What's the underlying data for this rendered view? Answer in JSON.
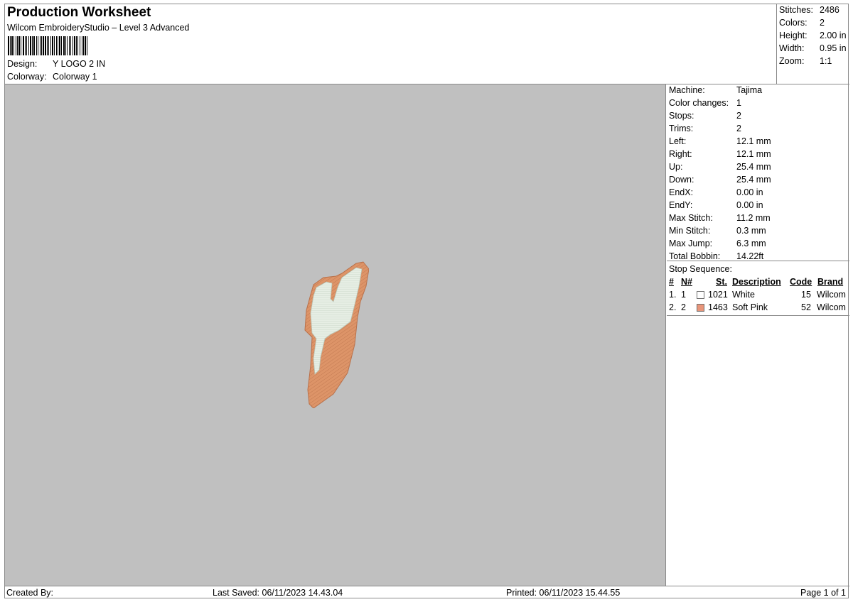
{
  "header": {
    "title": "Production Worksheet",
    "subtitle": "Wilcom EmbroideryStudio – Level 3 Advanced",
    "design_label": "Design:",
    "design_value": "Y LOGO 2 IN",
    "colorway_label": "Colorway:",
    "colorway_value": "Colorway 1"
  },
  "summary": [
    {
      "label": "Stitches:",
      "value": "2486"
    },
    {
      "label": "Colors:",
      "value": "2"
    },
    {
      "label": "Height:",
      "value": "2.00 in"
    },
    {
      "label": "Width:",
      "value": "0.95 in"
    },
    {
      "label": "Zoom:",
      "value": "1:1"
    }
  ],
  "machine_info": [
    {
      "label": "Machine:",
      "value": "Tajima"
    },
    {
      "label": "Color changes:",
      "value": "1"
    },
    {
      "label": "Stops:",
      "value": "2"
    },
    {
      "label": "Trims:",
      "value": "2"
    },
    {
      "label": "Left:",
      "value": "12.1 mm"
    },
    {
      "label": "Right:",
      "value": "12.1 mm"
    },
    {
      "label": "Up:",
      "value": "25.4 mm"
    },
    {
      "label": "Down:",
      "value": "25.4 mm"
    },
    {
      "label": "EndX:",
      "value": "0.00 in"
    },
    {
      "label": "EndY:",
      "value": "0.00 in"
    },
    {
      "label": "Max Stitch:",
      "value": "11.2 mm"
    },
    {
      "label": "Min Stitch:",
      "value": "0.3 mm"
    },
    {
      "label": "Max Jump:",
      "value": "6.3 mm"
    },
    {
      "label": "Total Bobbin:",
      "value": "14.22ft"
    }
  ],
  "stop_sequence": {
    "label": "Stop Sequence:",
    "columns": {
      "num": "#",
      "needle": "N#",
      "stitches": "St.",
      "description": "Description",
      "code": "Code",
      "brand": "Brand"
    },
    "rows": [
      {
        "num": "1.",
        "needle": "1",
        "code_num": "1021",
        "description": "White",
        "code": "15",
        "brand": "Wilcom",
        "color": "#ffffff"
      },
      {
        "num": "2.",
        "needle": "2",
        "code_num": "1463",
        "description": "Soft Pink",
        "code": "52",
        "brand": "Wilcom",
        "color": "#e8957a"
      }
    ]
  },
  "colors": {
    "preview_bg": "#c0c0c0",
    "white_thread": "#e6eee4",
    "pink_thread": "#dd9468"
  },
  "footer": {
    "created_by": "Created By:",
    "last_saved": "Last Saved: 06/11/2023 14.43.04",
    "printed": "Printed: 06/11/2023 15.44.55",
    "page": "Page 1 of 1"
  }
}
